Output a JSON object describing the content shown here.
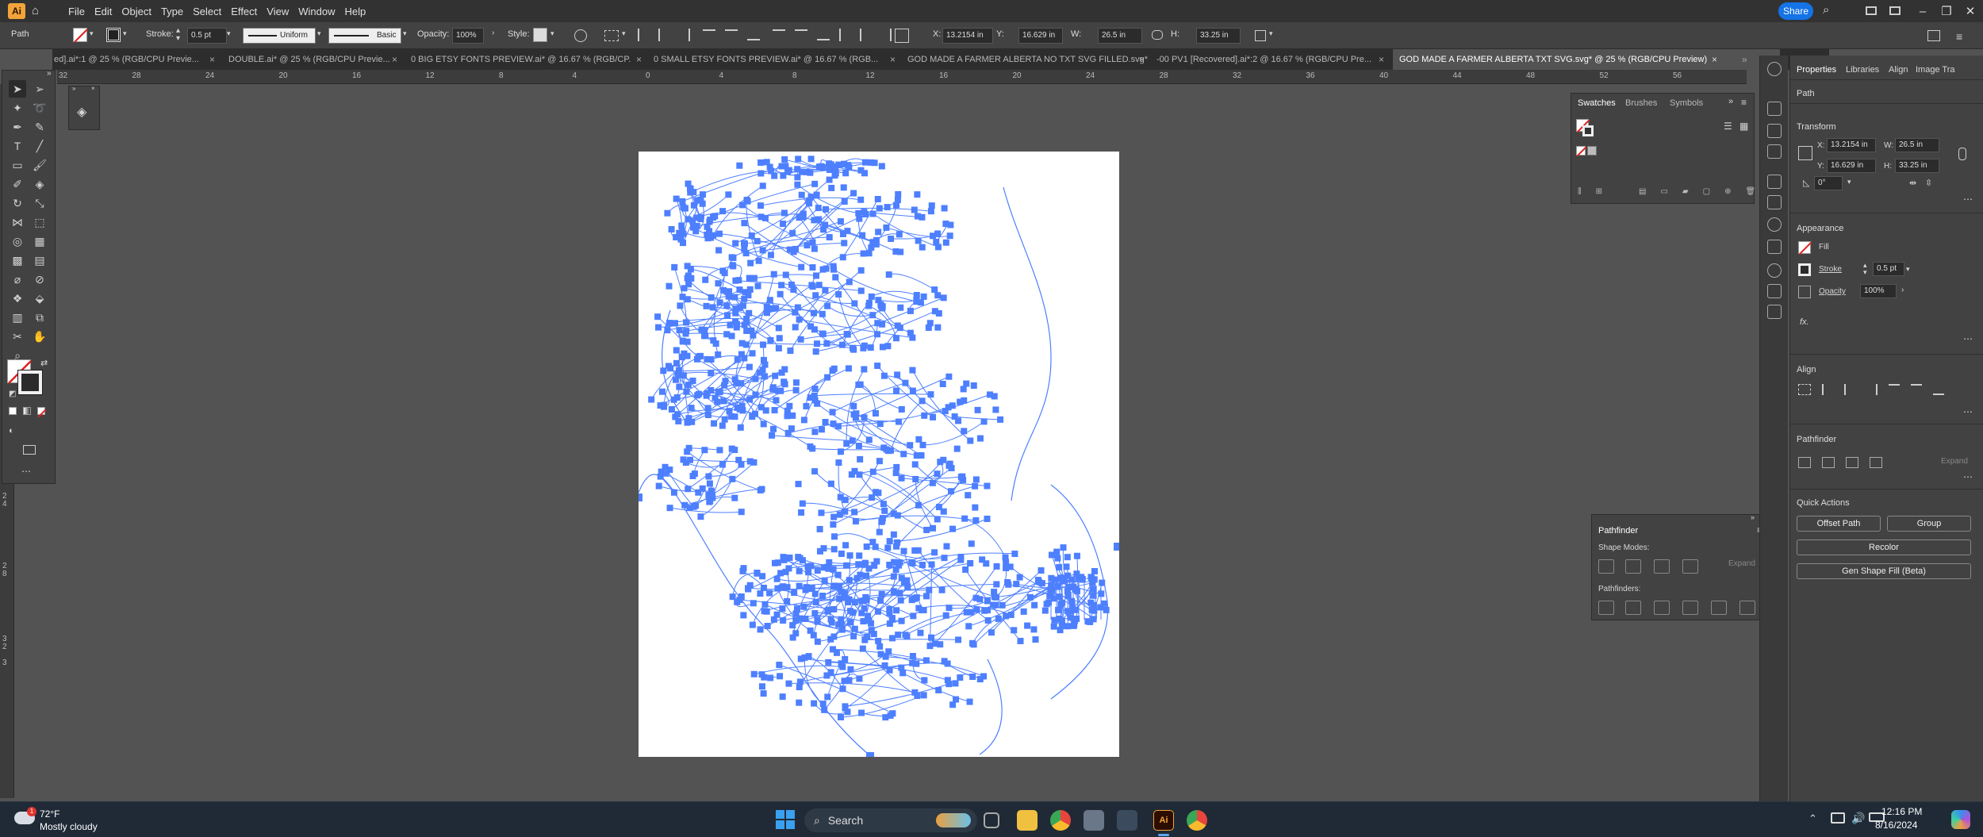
{
  "menubar": {
    "items": [
      "File",
      "Edit",
      "Object",
      "Type",
      "Select",
      "Effect",
      "View",
      "Window",
      "Help"
    ],
    "share_label": "Share"
  },
  "control_bar": {
    "selection_type": "Path",
    "stroke_label": "Stroke:",
    "stroke_value": "0.5 pt",
    "stroke_profile": "Uniform",
    "brush": "Basic",
    "opacity_label": "Opacity:",
    "opacity_value": "100%",
    "style_label": "Style:",
    "x_label": "X:",
    "x_value": "13.2154 in",
    "y_label": "Y:",
    "y_value": "16.629 in",
    "w_label": "W:",
    "w_value": "26.5 in",
    "h_label": "H:",
    "h_value": "33.25 in"
  },
  "tabs": [
    "ed].ai*:1 @ 25 % (RGB/CPU Previe...",
    "DOUBLE.ai* @ 25 % (RGB/CPU Previe...",
    "0 BIG ETSY FONTS PREVIEW.ai* @ 16.67 % (RGB/CP...",
    "0 SMALL ETSY FONTS PREVIEW.ai* @ 16.67 % (RGB...",
    "GOD MADE A FARMER ALBERTA NO TXT SVG FILLED.svg*",
    "-00 PV1 [Recovered].ai*:2 @ 16.67 % (RGB/CPU Pre...",
    "GOD MADE A FARMER ALBERTA TXT SVG.svg* @ 25 % (RGB/CPU Preview)"
  ],
  "ruler_h": [
    "32",
    "28",
    "24",
    "20",
    "16",
    "12",
    "8",
    "4",
    "0",
    "4",
    "8",
    "12",
    "16",
    "20",
    "24",
    "28",
    "32",
    "36",
    "40",
    "44",
    "48",
    "52",
    "56",
    "60"
  ],
  "ruler_v": [
    "2",
    "0",
    "2",
    "4",
    "2",
    "8",
    "3",
    "2",
    "3"
  ],
  "swatches": {
    "tabs": [
      "Swatches",
      "Brushes",
      "Symbols"
    ]
  },
  "pathfinder": {
    "title": "Pathfinder",
    "shape_modes_label": "Shape Modes:",
    "pathfinders_label": "Pathfinders:",
    "expand_label": "Expand"
  },
  "properties": {
    "tabs": [
      "Properties",
      "Libraries",
      "Align",
      "Image Tra"
    ],
    "selection": "Path",
    "transform_label": "Transform",
    "x_label": "X:",
    "x_value": "13.2154 in",
    "y_label": "Y:",
    "y_value": "16.629 in",
    "w_label": "W:",
    "w_value": "26.5 in",
    "h_label": "H:",
    "h_value": "33.25 in",
    "rotate_value": "0°",
    "appearance_label": "Appearance",
    "fill_label": "Fill",
    "stroke_label": "Stroke",
    "stroke_value": "0.5 pt",
    "opacity_label": "Opacity",
    "opacity_value": "100%",
    "fx_label": "fx.",
    "align_label": "Align",
    "pathfinder_label": "Pathfinder",
    "expand_label": "Expand",
    "quick_actions_label": "Quick Actions",
    "offset_path_label": "Offset Path",
    "group_label": "Group",
    "recolor_label": "Recolor",
    "gen_shape_fill_label": "Gen Shape Fill (Beta)"
  },
  "taskbar": {
    "weather_temp": "72°F",
    "weather_desc": "Mostly cloudy",
    "weather_badge": "1",
    "search_label": "Search",
    "time": "12:16 PM",
    "date": "8/16/2024"
  },
  "colors": {
    "selection_blue": "#4d7fff",
    "accent": "#1473e6"
  }
}
